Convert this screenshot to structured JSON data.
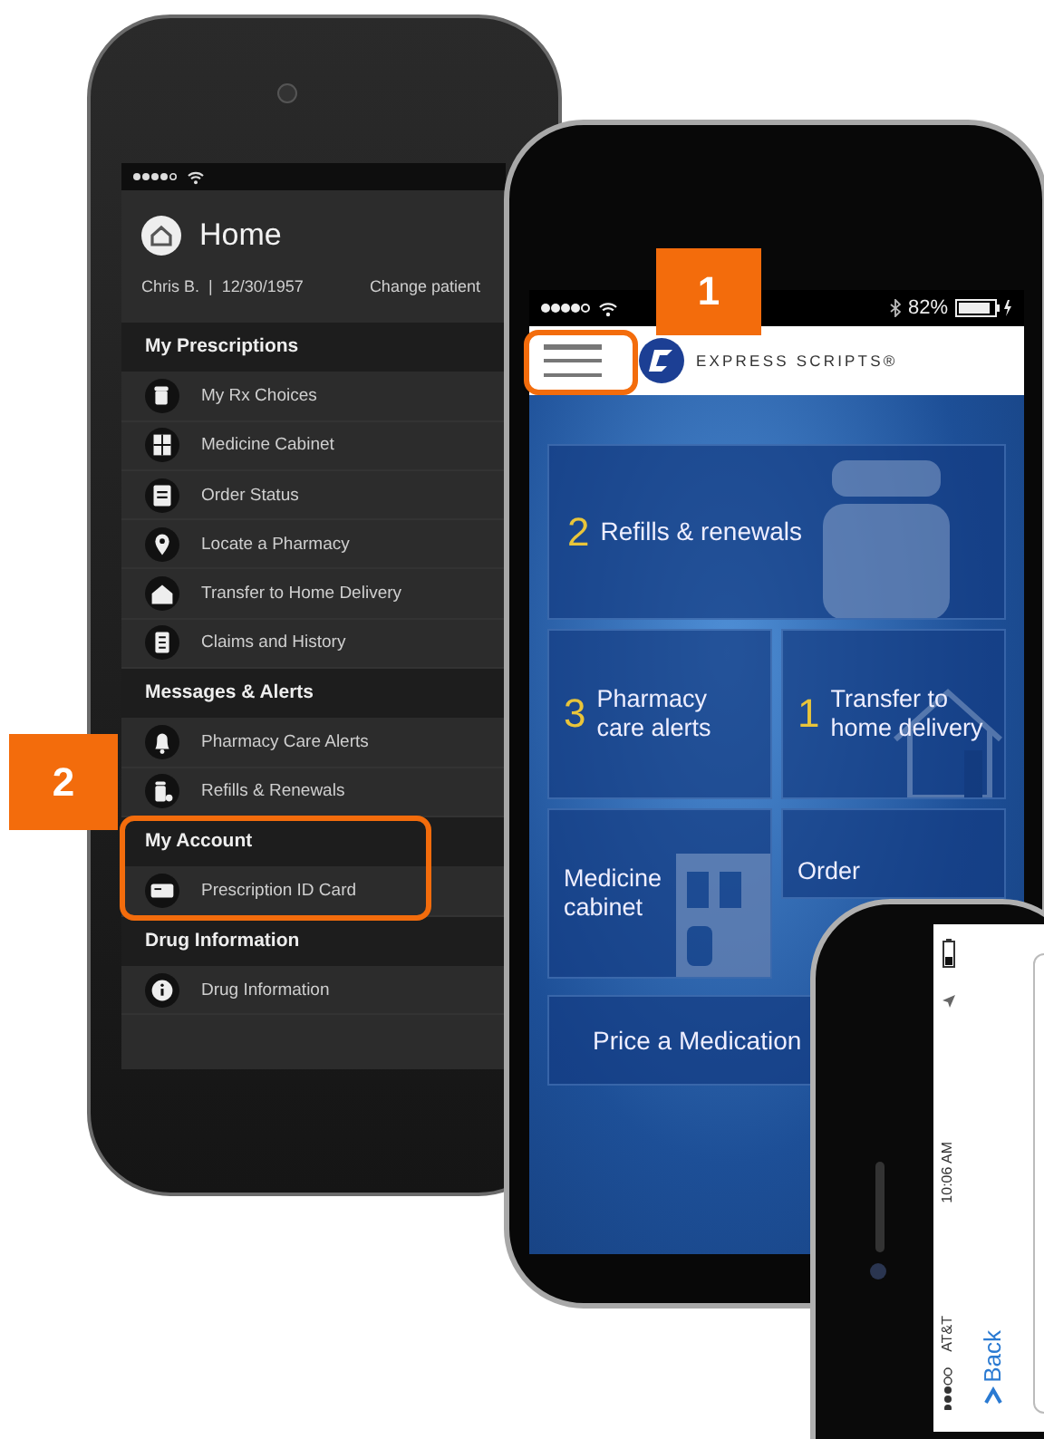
{
  "menu_phone": {
    "title": "Home",
    "patient": "Chris B.  |  12/30/1957",
    "change_patient": "Change patient",
    "sections": [
      {
        "title": "My Prescriptions",
        "items": [
          {
            "label": "My Rx Choices"
          },
          {
            "label": "Medicine Cabinet"
          },
          {
            "label": "Order Status"
          },
          {
            "label": "Locate a Pharmacy"
          },
          {
            "label": "Transfer to Home Delivery"
          },
          {
            "label": "Claims and History"
          }
        ]
      },
      {
        "title": "Messages & Alerts",
        "items": [
          {
            "label": "Pharmacy Care Alerts"
          },
          {
            "label": "Refills & Renewals"
          }
        ]
      },
      {
        "title": "My Account",
        "items": [
          {
            "label": "Prescription ID Card"
          }
        ]
      },
      {
        "title": "Drug Information",
        "items": [
          {
            "label": "Drug Information"
          }
        ]
      }
    ]
  },
  "home_phone": {
    "battery": "82%",
    "brand": "EXPRESS SCRIPTS®",
    "tiles": [
      {
        "kind": "wide",
        "count": "2",
        "label": "Refills & renewals"
      },
      {
        "kind": "half",
        "count": "3",
        "label": "Pharmacy care alerts"
      },
      {
        "kind": "half",
        "count": "1",
        "label": "Transfer to home delivery"
      },
      {
        "kind": "half",
        "label": "Medicine cabinet"
      },
      {
        "kind": "half",
        "label": "Order"
      },
      {
        "kind": "bar",
        "label": "Price a Medication"
      }
    ]
  },
  "landscape_phone": {
    "time": "10:06 AM",
    "carrier": "AT&T",
    "back": "Back"
  },
  "callouts": [
    {
      "number": "1"
    },
    {
      "number": "2"
    }
  ]
}
